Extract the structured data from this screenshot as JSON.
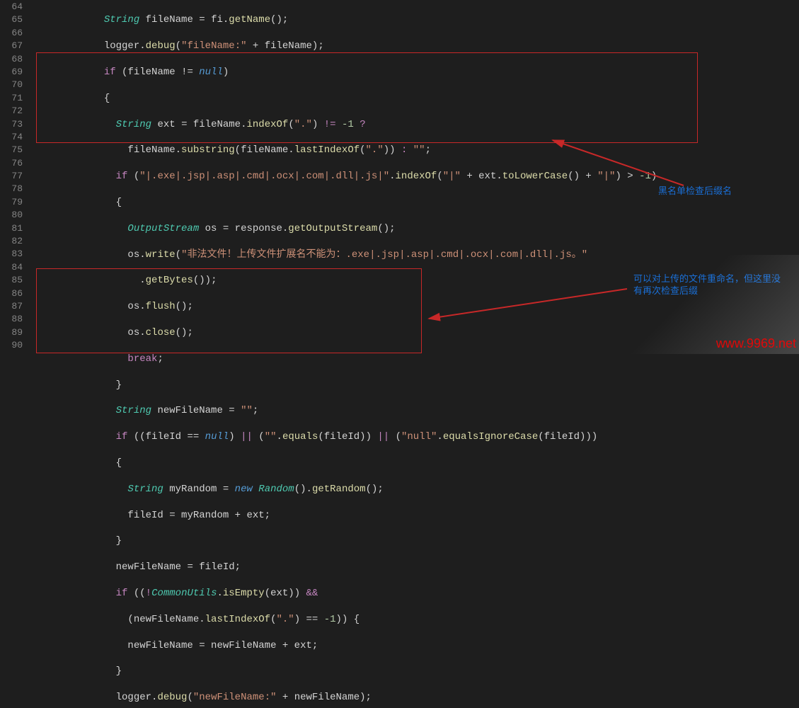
{
  "gutter": {
    "start": 64,
    "end": 90
  },
  "code": {
    "l64_a": "String",
    "l64_b": " fileName ",
    "l64_c": "=",
    "l64_d": " fi",
    "l64_e": ".",
    "l64_f": "getName",
    "l64_g": "();",
    "l65_a": "logger",
    "l65_b": ".",
    "l65_c": "debug",
    "l65_d": "(",
    "l65_e": "\"fileName:\"",
    "l65_f": " + fileName",
    "l65_g": ");",
    "l66_a": "if",
    "l66_b": " (fileName ",
    "l66_c": "!=",
    "l66_d": " ",
    "l66_e": "null",
    "l66_f": ")",
    "l67": "{",
    "l68_a": "String",
    "l68_b": " ext ",
    "l68_c": "=",
    "l68_d": " fileName",
    "l68_e": ".",
    "l68_f": "indexOf",
    "l68_g": "(",
    "l68_h": "\".\"",
    "l68_i": ") ",
    "l68_j": "!=",
    "l68_k": " ",
    "l68_l": "-1",
    "l68_m": " ",
    "l68_n": "?",
    "l69_a": "fileName",
    "l69_b": ".",
    "l69_c": "substring",
    "l69_d": "(fileName",
    "l69_e": ".",
    "l69_f": "lastIndexOf",
    "l69_g": "(",
    "l69_h": "\".\"",
    "l69_i": ")) ",
    "l69_j": ":",
    "l69_k": " ",
    "l69_l": "\"\"",
    "l69_m": ";",
    "l70_a": "if",
    "l70_b": " (",
    "l70_c": "\"|.exe|.jsp|.asp|.cmd|.ocx|.com|.dll|.js|\"",
    "l70_d": ".",
    "l70_e": "indexOf",
    "l70_f": "(",
    "l70_g": "\"|\"",
    "l70_h": " + ext",
    "l70_i": ".",
    "l70_j": "toLowerCase",
    "l70_k": "() + ",
    "l70_l": "\"|\"",
    "l70_m": ") ",
    "l70_n": ">",
    "l70_o": " ",
    "l70_p": "-1",
    "l70_q": ")",
    "l71": "{",
    "l72_a": "OutputStream",
    "l72_b": " os ",
    "l72_c": "=",
    "l72_d": " response",
    "l72_e": ".",
    "l72_f": "getOutputStream",
    "l72_g": "();",
    "l73_a": "os",
    "l73_b": ".",
    "l73_c": "write",
    "l73_d": "(",
    "l73_e": "\"非法文件！上传文件扩展名不能为：.exe|.jsp|.asp|.cmd|.ocx|.com|.dll|.js。\"",
    "l74_a": ".",
    "l74_b": "getBytes",
    "l74_c": "());",
    "l75_a": "os",
    "l75_b": ".",
    "l75_c": "flush",
    "l75_d": "();",
    "l76_a": "os",
    "l76_b": ".",
    "l76_c": "close",
    "l76_d": "();",
    "l77_a": "break",
    "l77_b": ";",
    "l78": "}",
    "l79_a": "String",
    "l79_b": " newFileName ",
    "l79_c": "=",
    "l79_d": " ",
    "l79_e": "\"\"",
    "l79_f": ";",
    "l80_a": "if",
    "l80_b": " ((fileId ",
    "l80_c": "==",
    "l80_d": " ",
    "l80_e": "null",
    "l80_f": ") ",
    "l80_g": "||",
    "l80_h": " (",
    "l80_i": "\"\"",
    "l80_j": ".",
    "l80_k": "equals",
    "l80_l": "(fileId)) ",
    "l80_m": "||",
    "l80_n": " (",
    "l80_o": "\"null\"",
    "l80_p": ".",
    "l80_q": "equalsIgnoreCase",
    "l80_r": "(fileId)))",
    "l81": "{",
    "l82_a": "String",
    "l82_b": " myRandom ",
    "l82_c": "=",
    "l82_d": " ",
    "l82_e": "new",
    "l82_f": " ",
    "l82_g": "Random",
    "l82_h": "().",
    "l82_i": "getRandom",
    "l82_j": "();",
    "l83_a": "fileId ",
    "l83_b": "=",
    "l83_c": " myRandom + ext;",
    "l84": "}",
    "l85_a": "newFileName ",
    "l85_b": "=",
    "l85_c": " fileId;",
    "l86_a": "if",
    "l86_b": " ((",
    "l86_c": "!",
    "l86_d": "CommonUtils",
    "l86_e": ".",
    "l86_f": "isEmpty",
    "l86_g": "(ext)) ",
    "l86_h": "&&",
    "l87_a": "(newFileName",
    "l87_b": ".",
    "l87_c": "lastIndexOf",
    "l87_d": "(",
    "l87_e": "\".\"",
    "l87_f": ") ",
    "l87_g": "==",
    "l87_h": " ",
    "l87_i": "-1",
    "l87_j": ")) {",
    "l88_a": "newFileName ",
    "l88_b": "=",
    "l88_c": " newFileName + ext;",
    "l89": "}",
    "l90_a": "logger",
    "l90_b": ".",
    "l90_c": "debug",
    "l90_d": "(",
    "l90_e": "\"newFileName:\"",
    "l90_f": " + newFileName",
    "l90_g": ");"
  },
  "annotations": {
    "a1": "黑名单检查后缀名",
    "a2": "可以对上传的文件重命名，但这里没\n有再次检查后缀"
  },
  "watermark": "www.9969.net"
}
